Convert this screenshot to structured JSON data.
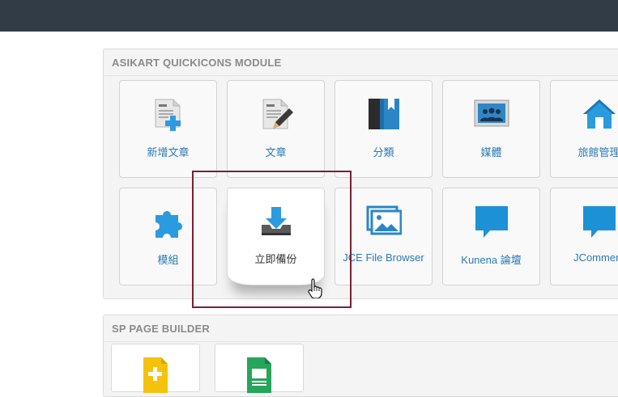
{
  "module1": {
    "title": "ASIKART QUICKICONS MODULE",
    "tiles": [
      {
        "label": "新增文章",
        "icon": "add-article-icon"
      },
      {
        "label": "文章",
        "icon": "article-icon"
      },
      {
        "label": "分類",
        "icon": "category-icon"
      },
      {
        "label": "媒體",
        "icon": "media-icon"
      },
      {
        "label": "旅館管理",
        "icon": "home-icon"
      },
      {
        "label": "模組",
        "icon": "puzzle-icon"
      },
      {
        "label": "立即備份",
        "icon": "download-icon"
      },
      {
        "label": "JCE File Browser",
        "icon": "image-browser-icon"
      },
      {
        "label": "Kunena 論壇",
        "icon": "chat-bubble-icon"
      },
      {
        "label": "JComment",
        "icon": "chat-bubble-icon"
      }
    ]
  },
  "module2": {
    "title": "SP PAGE BUILDER",
    "tiles": [
      {
        "icon": "add-page-icon",
        "color": "#f4c20d"
      },
      {
        "icon": "pages-icon",
        "color": "#27a55a"
      }
    ]
  },
  "colors": {
    "accent": "#2b7ab6",
    "topbar": "#323c46",
    "highlight": "#7b1f34"
  }
}
